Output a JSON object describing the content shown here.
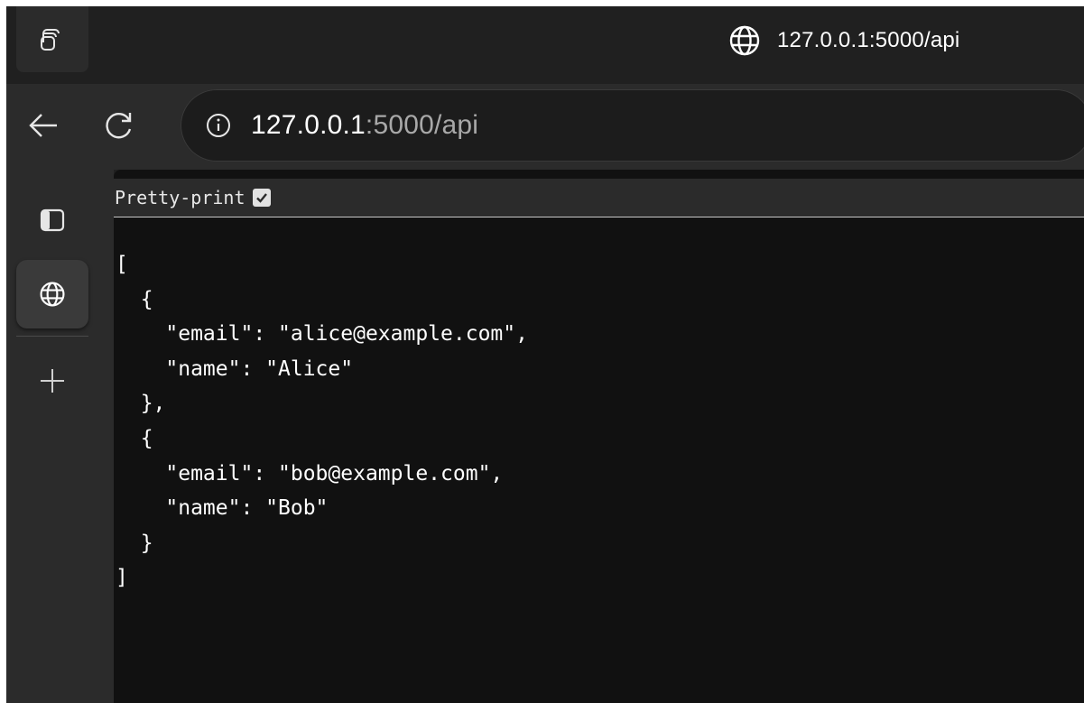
{
  "titlebar": {
    "title": "127.0.0.1:5000/api",
    "icons": {
      "tab_actions": "workspaces-icon",
      "site": "globe-icon"
    }
  },
  "toolbar": {
    "icons": {
      "back": "back-arrow-icon",
      "refresh": "refresh-icon",
      "site_info": "info-icon"
    },
    "url_host": "127.0.0.1",
    "url_rest": ":5000/api"
  },
  "sidebar": {
    "icons": [
      "tab-icon",
      "globe-icon",
      "plus-icon"
    ]
  },
  "pretty_print": {
    "label": "Pretty-print",
    "checked": true
  },
  "json_lines": [
    "[",
    "  {",
    "    \"email\": \"alice@example.com\",",
    "    \"name\": \"Alice\"",
    "  },",
    "  {",
    "    \"email\": \"bob@example.com\",",
    "    \"name\": \"Bob\"",
    "  }",
    "]"
  ],
  "colors": {
    "frame": "#202020",
    "toolbar": "#2b2b2b",
    "content_bg": "#111111",
    "text": "#ffffff",
    "url_dim": "#a8a8a8"
  }
}
